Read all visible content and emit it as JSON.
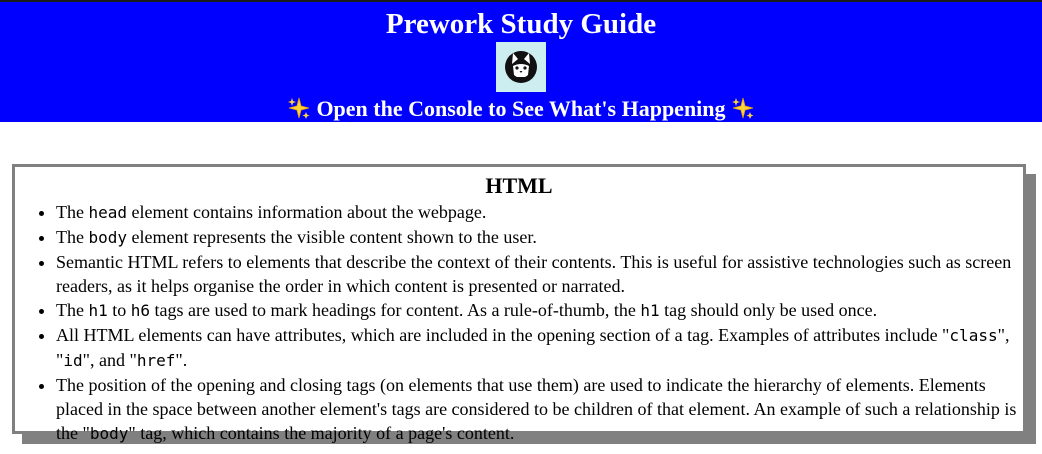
{
  "header": {
    "title": "Prework Study Guide",
    "logo_icon": "cat-face-logo-icon",
    "subtitle": "Open the Console to See What's Happening",
    "sparkle_icon": "sparkles-emoji-icon",
    "background_color": "#0000ff",
    "text_color": "#ffffff"
  },
  "section": {
    "title": "HTML",
    "items": [
      {
        "t1": "The ",
        "c1": "head",
        "t2": " element contains information about the webpage."
      },
      {
        "t1": "The ",
        "c1": "body",
        "t2": " element represents the visible content shown to the user."
      },
      {
        "t1": "Semantic HTML refers to elements that describe the context of their contents. This is useful for assistive technologies such as screen readers, as it helps organise the order in which content is presented or narrated."
      },
      {
        "t1": "The ",
        "c1": "h1",
        "t2": " to ",
        "c2": "h6",
        "t3": " tags are used to mark headings for content. As a rule-of-thumb, the ",
        "c3": "h1",
        "t4": " tag should only be used once."
      },
      {
        "t1": "All HTML elements can have attributes, which are included in the opening section of a tag. Examples of attributes include \"",
        "c1": "class",
        "t2": "\", \"",
        "c2": "id",
        "t3": "\", and \"",
        "c3": "href",
        "t4": "\"."
      },
      {
        "t1": "The position of the opening and closing tags (on elements that use them) are used to indicate the hierarchy of elements. Elements placed in the space between another element's tags are considered to be children of that element. An example of such a relationship is the \"",
        "c1": "body",
        "t2": "\" tag, which contains the majority of a page's content."
      }
    ]
  }
}
